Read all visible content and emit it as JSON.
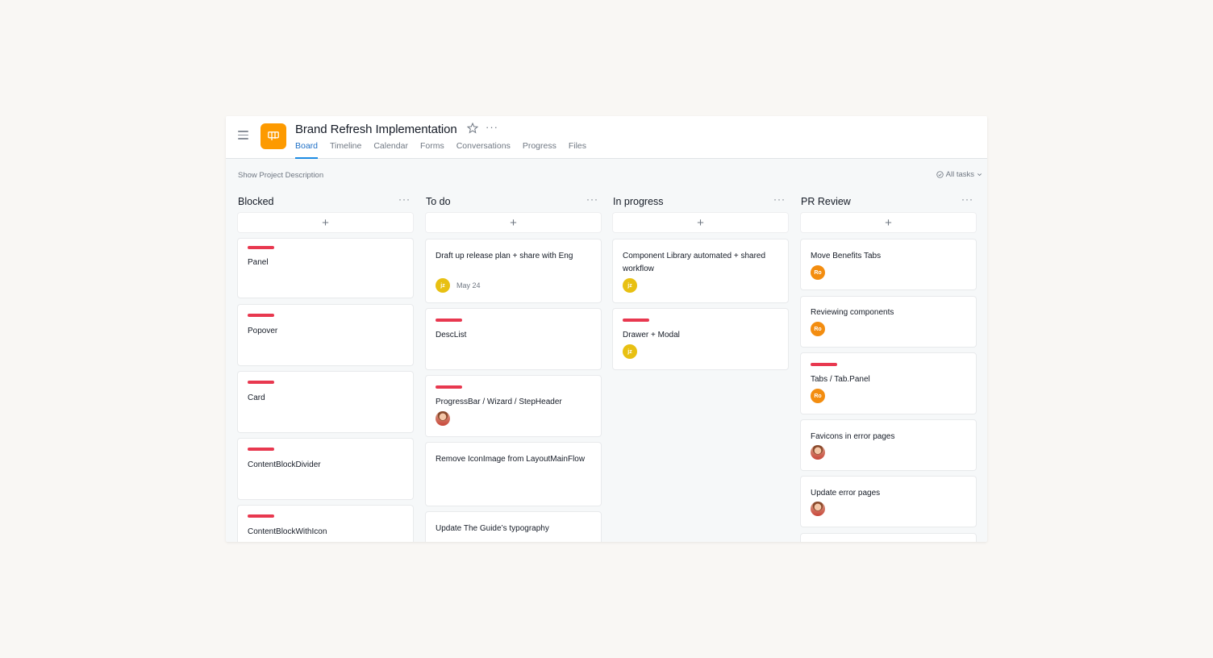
{
  "header": {
    "title": "Brand Refresh Implementation",
    "more": "···",
    "tabs": [
      "Board",
      "Timeline",
      "Calendar",
      "Forms",
      "Conversations",
      "Progress",
      "Files"
    ]
  },
  "subbar": {
    "show_description": "Show Project Description",
    "all_tasks": "All tasks"
  },
  "colors": {
    "accent": "#1d8be3",
    "project_icon": "#fd9a00",
    "tag_red": "#e8384f",
    "avatar_jz": "#e8c012",
    "avatar_ro": "#f38d10"
  },
  "columns": [
    {
      "title": "Blocked",
      "cards": [
        {
          "title": "Panel"
        },
        {
          "title": "Popover"
        },
        {
          "title": "Card"
        },
        {
          "title": "ContentBlockDivider"
        },
        {
          "title": "ContentBlockWithIcon"
        }
      ]
    },
    {
      "title": "To do",
      "cards": [
        {
          "title": "Draft up release plan + share with Eng",
          "avatar": "jz",
          "due": "May 24"
        },
        {
          "title": "DescList"
        },
        {
          "title": "ProgressBar / Wizard / StepHeader"
        },
        {
          "title": "Remove IconImage from LayoutMainFlow"
        },
        {
          "title": "Update The Guide’s typography"
        }
      ]
    },
    {
      "title": "In progress",
      "cards": [
        {
          "title": "Component Library automated + shared workflow",
          "avatar": "jz"
        },
        {
          "title": "Drawer + Modal",
          "avatar": "jz"
        }
      ]
    },
    {
      "title": "PR Review",
      "cards": [
        {
          "title": "Move Benefits Tabs",
          "avatar": "Ro"
        },
        {
          "title": "Reviewing components",
          "avatar": "Ro"
        },
        {
          "title": "Tabs / Tab.Panel",
          "avatar": "Ro"
        },
        {
          "title": "Favicons in error pages"
        },
        {
          "title": "Update error pages"
        }
      ]
    }
  ]
}
